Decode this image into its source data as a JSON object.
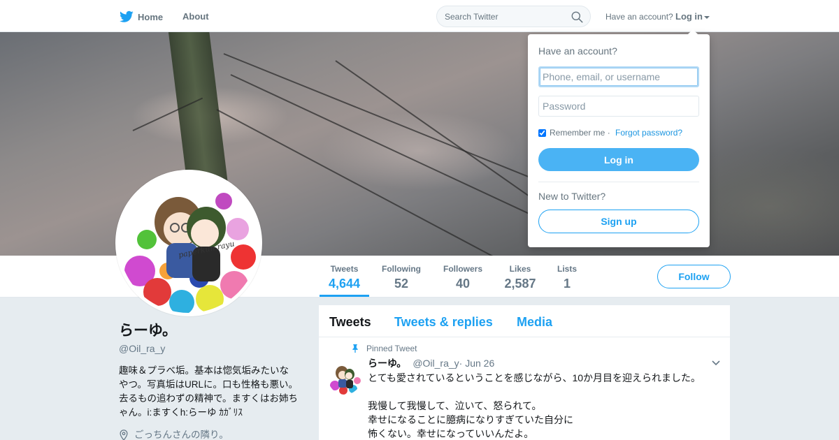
{
  "nav": {
    "logo_icon": "twitter-bird-icon",
    "home_label": "Home",
    "about_label": "About",
    "search_placeholder": "Search Twitter",
    "have_account": "Have an account?",
    "login_label": "Log in"
  },
  "colors": {
    "accent": "#1da1f2",
    "login_button": "#4ab3f4",
    "text_muted": "#657786",
    "page_bg": "#e6ecf0"
  },
  "profile_nav": {
    "stats": [
      {
        "label": "Tweets",
        "value": "4,644",
        "active": true
      },
      {
        "label": "Following",
        "value": "52"
      },
      {
        "label": "Followers",
        "value": "40"
      },
      {
        "label": "Likes",
        "value": "2,587"
      },
      {
        "label": "Lists",
        "value": "1"
      }
    ],
    "follow_label": "Follow"
  },
  "profile": {
    "name": "らーゆ。",
    "handle": "@Oil_ra_y",
    "bio": "趣味＆プラべ垢。基本は惚気垢みたいなやつ。写真垢はURLに。口も性格も悪い。去るもの追わずの精神で。ますくはお姉ちゃん。i:ますくh:らーゆ ｶｶﾞﾘｽ",
    "location": "ごっちんさんの隣り。",
    "avatar_signature": "paperkun.rayu"
  },
  "timeline": {
    "tabs": [
      "Tweets",
      "Tweets & replies",
      "Media"
    ],
    "pinned_label": "Pinned Tweet",
    "tweet": {
      "name": "らーゆ。",
      "handle": "@Oil_ra_y",
      "date": " · Jun 26",
      "lines": [
        "とても愛されているということを感じながら、10か月目を迎えられました。",
        "",
        "我慢して我慢して、泣いて、怒られて。",
        "幸せになることに臆病になりすぎていた自分に",
        "怖くない。幸せになっていいんだよ。"
      ]
    }
  },
  "login_dropdown": {
    "title": "Have an account?",
    "username_placeholder": "Phone, email, or username",
    "password_placeholder": "Password",
    "remember_label": "Remember me",
    "separator": " · ",
    "forgot_label": "Forgot password?",
    "remember_checked": true,
    "login_button": "Log in",
    "new_to_twitter": "New to Twitter?",
    "signup_button": "Sign up"
  }
}
